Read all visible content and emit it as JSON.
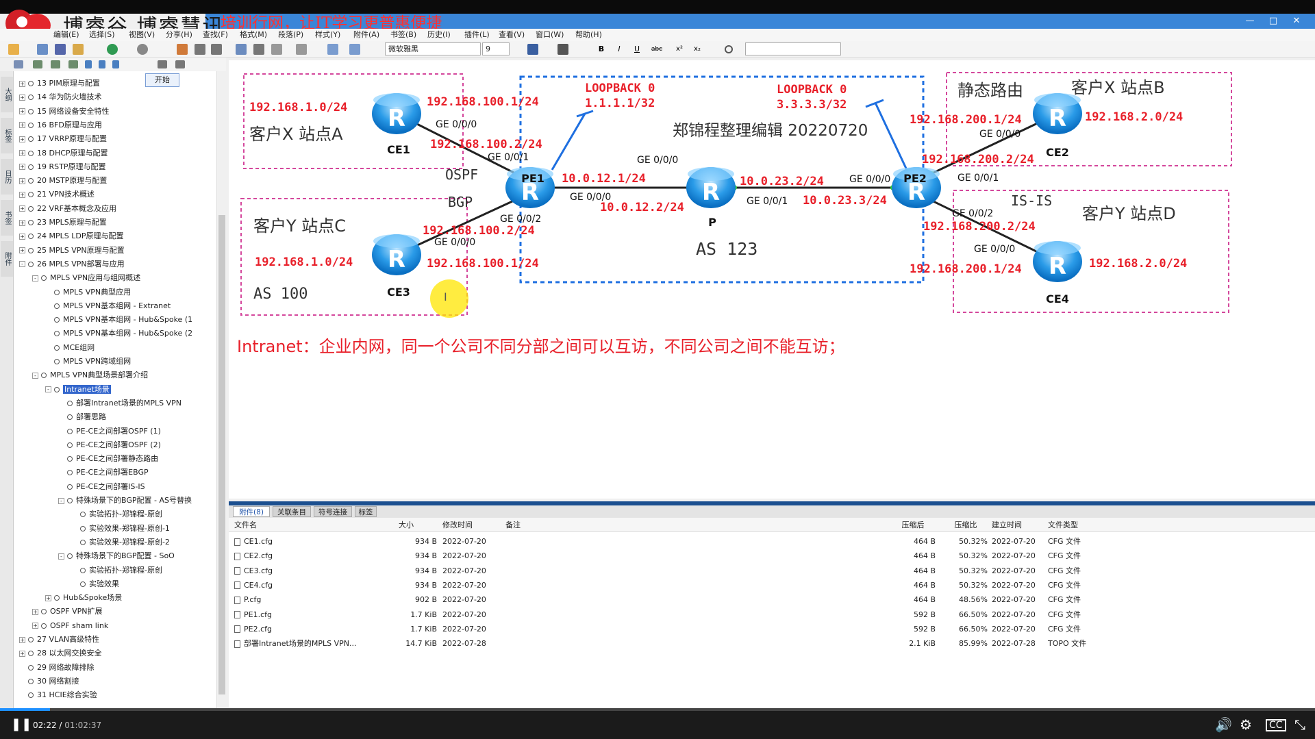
{
  "branding": {
    "name": "博睿谷 博睿慧讯",
    "slogan": "培训行网，让IT学习更普惠便捷"
  },
  "window": {
    "title": "",
    "controls": [
      "—",
      "□",
      "✕"
    ]
  },
  "menu": [
    "编辑(E)",
    "选择(S)",
    "视图(V)",
    "分享(H)",
    "查找(F)",
    "格式(M)",
    "段落(P)",
    "样式(Y)",
    "附件(A)",
    "书签(B)",
    "历史(I)",
    "插件(L)",
    "查看(V)",
    "窗口(W)",
    "帮助(H)"
  ],
  "toolbar": {
    "font_name": "微软雅黑",
    "font_size": "9",
    "bold": "B",
    "italic": "I",
    "underline": "U",
    "strike": "abc",
    "sup": "x²",
    "sub": "x₂"
  },
  "tree": {
    "start_button": "开始",
    "items": [
      {
        "label": "13 PIM原理与配置",
        "level": 0,
        "toggle": "+"
      },
      {
        "label": "14 华为防火墙技术",
        "level": 0,
        "toggle": "+"
      },
      {
        "label": "15 网络设备安全特性",
        "level": 0,
        "toggle": "+"
      },
      {
        "label": "16 BFD原理与应用",
        "level": 0,
        "toggle": "+"
      },
      {
        "label": "17 VRRP原理与配置",
        "level": 0,
        "toggle": "+"
      },
      {
        "label": "18 DHCP原理与配置",
        "level": 0,
        "toggle": "+"
      },
      {
        "label": "19 RSTP原理与配置",
        "level": 0,
        "toggle": "+"
      },
      {
        "label": "20 MSTP原理与配置",
        "level": 0,
        "toggle": "+"
      },
      {
        "label": "21 VPN技术概述",
        "level": 0,
        "toggle": "+"
      },
      {
        "label": "22 VRF基本概念及应用",
        "level": 0,
        "toggle": "+"
      },
      {
        "label": "23 MPLS原理与配置",
        "level": 0,
        "toggle": "+"
      },
      {
        "label": "24 MPLS LDP原理与配置",
        "level": 0,
        "toggle": "+"
      },
      {
        "label": "25 MPLS VPN原理与配置",
        "level": 0,
        "toggle": "+"
      },
      {
        "label": "26 MPLS VPN部署与应用",
        "level": 0,
        "toggle": "-"
      },
      {
        "label": "MPLS VPN应用与组网概述",
        "level": 1,
        "toggle": "-"
      },
      {
        "label": "MPLS VPN典型应用",
        "level": 2,
        "toggle": ""
      },
      {
        "label": "MPLS VPN基本组网 - Extranet",
        "level": 2,
        "toggle": ""
      },
      {
        "label": "MPLS VPN基本组网 - Hub&Spoke (1",
        "level": 2,
        "toggle": ""
      },
      {
        "label": "MPLS VPN基本组网 - Hub&Spoke (2",
        "level": 2,
        "toggle": ""
      },
      {
        "label": "MCE组网",
        "level": 2,
        "toggle": ""
      },
      {
        "label": "MPLS VPN跨域组网",
        "level": 2,
        "toggle": ""
      },
      {
        "label": "MPLS VPN典型场景部署介绍",
        "level": 1,
        "toggle": "-"
      },
      {
        "label": "Intranet场景",
        "level": 2,
        "toggle": "-",
        "selected": true
      },
      {
        "label": "部署Intranet场景的MPLS VPN",
        "level": 3,
        "toggle": ""
      },
      {
        "label": "部署思路",
        "level": 3,
        "toggle": ""
      },
      {
        "label": "PE-CE之间部署OSPF (1)",
        "level": 3,
        "toggle": ""
      },
      {
        "label": "PE-CE之间部署OSPF (2)",
        "level": 3,
        "toggle": ""
      },
      {
        "label": "PE-CE之间部署静态路由",
        "level": 3,
        "toggle": ""
      },
      {
        "label": "PE-CE之间部署EBGP",
        "level": 3,
        "toggle": ""
      },
      {
        "label": "PE-CE之间部署IS-IS",
        "level": 3,
        "toggle": ""
      },
      {
        "label": "特殊场景下的BGP配置 - AS号替换",
        "level": 3,
        "toggle": "-"
      },
      {
        "label": "实验拓扑-郑锦程-原创",
        "level": 4,
        "toggle": ""
      },
      {
        "label": "实验效果-郑锦程-原创-1",
        "level": 4,
        "toggle": ""
      },
      {
        "label": "实验效果-郑锦程-原创-2",
        "level": 4,
        "toggle": ""
      },
      {
        "label": "特殊场景下的BGP配置 - SoO",
        "level": 3,
        "toggle": "-"
      },
      {
        "label": "实验拓扑-郑锦程-原创",
        "level": 4,
        "toggle": ""
      },
      {
        "label": "实验效果",
        "level": 4,
        "toggle": ""
      },
      {
        "label": "Hub&Spoke场景",
        "level": 2,
        "toggle": "+"
      },
      {
        "label": "OSPF VPN扩展",
        "level": 1,
        "toggle": "+"
      },
      {
        "label": "OSPF sham link",
        "level": 1,
        "toggle": "+"
      },
      {
        "label": "27 VLAN高级特性",
        "level": 0,
        "toggle": "+"
      },
      {
        "label": "28 以太网交换安全",
        "level": 0,
        "toggle": "+"
      },
      {
        "label": "29 网络故障排除",
        "level": 0,
        "toggle": ""
      },
      {
        "label": "30 网络割接",
        "level": 0,
        "toggle": ""
      },
      {
        "label": "31 HCIE综合实验",
        "level": 0,
        "toggle": ""
      }
    ]
  },
  "diagram": {
    "watermark_title": "郑锦程整理编辑 20220720",
    "as_core": "AS 123",
    "as_left": "AS 100",
    "ospf": "OSPF",
    "bgp": "BGP",
    "isis": "IS-IS",
    "static": "静态路由",
    "site_a": "客户X 站点A",
    "site_b": "客户X 站点B",
    "site_c": "客户Y 站点C",
    "site_d": "客户Y 站点D",
    "lb1_name": "LOOPBACK 0",
    "lb1_ip": "1.1.1.1/32",
    "lb2_name": "LOOPBACK 0",
    "lb2_ip": "3.3.3.3/32",
    "routers": {
      "ce1": "CE1",
      "ce2": "CE2",
      "ce3": "CE3",
      "ce4": "CE4",
      "pe1": "PE1",
      "pe2": "PE2",
      "p": "P",
      "r": "R"
    },
    "ip": {
      "ce1_lan": "192.168.1.0/24",
      "ce1_wan": "192.168.100.1/24",
      "pe1_ce1": "192.168.100.2/24",
      "pe1_ce3": "192.168.100.2/24",
      "ce3_wan": "192.168.100.1/24",
      "ce3_lan": "192.168.1.0/24",
      "pe1_p": "10.0.12.1/24",
      "p_pe1": "10.0.12.2/24",
      "p_pe2": "10.0.23.2/24",
      "pe2_p": "10.0.23.3/24",
      "ce2_wan": "192.168.200.1/24",
      "ce2_lan": "192.168.2.0/24",
      "pe2_ce2": "192.168.200.2/24",
      "pe2_ce4": "192.168.200.2/24",
      "ce4_wan": "192.168.200.1/24",
      "ce4_lan": "192.168.2.0/24"
    },
    "ifaces": {
      "ce1_g00": "GE 0/0/0",
      "pe1_g01": "GE 0/0/1",
      "pe1_g02": "GE 0/0/2",
      "ce3_g00": "GE 0/0/0",
      "pe1_g00": "GE 0/0/0",
      "p_g00_top": "GE 0/0/0",
      "p_g01": "GE 0/0/1",
      "pe2_g00": "GE 0/0/0",
      "pe2_g01": "GE 0/0/1",
      "pe2_g02": "GE 0/0/2",
      "ce2_g00": "GE 0/0/0",
      "ce4_g00": "GE 0/0/0"
    },
    "intranet_note": "Intranet：企业内网，同一个公司不同分部之间可以互访，不同公司之间不能互访；",
    "cursor": "I"
  },
  "tabs": [
    "附件(8)",
    "关联条目",
    "符号连接",
    "标签"
  ],
  "files": {
    "columns": [
      "文件名",
      "大小",
      "修改时间",
      "备注",
      "压缩后",
      "压缩比",
      "建立时间",
      "文件类型"
    ],
    "rows": [
      [
        "CE1.cfg",
        "934 B",
        "2022-07-20",
        "",
        "464 B",
        "50.32%",
        "2022-07-20",
        "CFG 文件"
      ],
      [
        "CE2.cfg",
        "934 B",
        "2022-07-20",
        "",
        "464 B",
        "50.32%",
        "2022-07-20",
        "CFG 文件"
      ],
      [
        "CE3.cfg",
        "934 B",
        "2022-07-20",
        "",
        "464 B",
        "50.32%",
        "2022-07-20",
        "CFG 文件"
      ],
      [
        "CE4.cfg",
        "934 B",
        "2022-07-20",
        "",
        "464 B",
        "50.32%",
        "2022-07-20",
        "CFG 文件"
      ],
      [
        "P.cfg",
        "902 B",
        "2022-07-20",
        "",
        "464 B",
        "48.56%",
        "2022-07-20",
        "CFG 文件"
      ],
      [
        "PE1.cfg",
        "1.7 KiB",
        "2022-07-20",
        "",
        "592 B",
        "66.50%",
        "2022-07-20",
        "CFG 文件"
      ],
      [
        "PE2.cfg",
        "1.7 KiB",
        "2022-07-20",
        "",
        "592 B",
        "66.50%",
        "2022-07-20",
        "CFG 文件"
      ],
      [
        "部署Intranet场景的MPLS VPN...",
        "14.7 KiB",
        "2022-07-28",
        "",
        "2.1 KiB",
        "85.99%",
        "2022-07-28",
        "TOPO 文件"
      ]
    ]
  },
  "player": {
    "current": "02:22",
    "separator": " / ",
    "duration": "01:02:37",
    "progress": 0.038
  },
  "colors": {
    "accent": "#3366cc",
    "red": "#e8202a",
    "pink_dash": "#d4479c",
    "blue_dash": "#1e6fe0"
  }
}
